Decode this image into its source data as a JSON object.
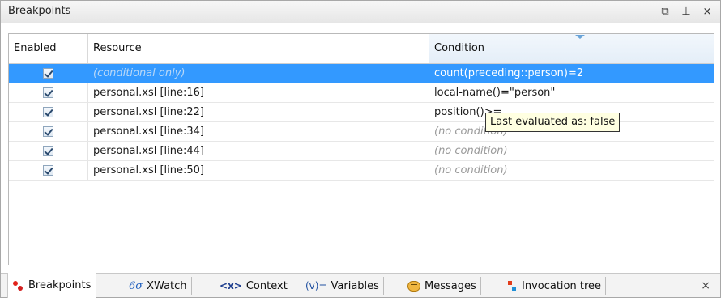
{
  "panel": {
    "title": "Breakpoints",
    "controls": {
      "restore_glyph": "⧉",
      "pin_glyph": "⊥",
      "close_glyph": "×"
    }
  },
  "table": {
    "headers": {
      "enabled": "Enabled",
      "resource": "Resource",
      "condition": "Condition"
    },
    "rows": [
      {
        "enabled": true,
        "resource": "(conditional only)",
        "condition": "count(preceding::person)=2",
        "selected": true
      },
      {
        "enabled": true,
        "resource": "personal.xsl [line:16]",
        "condition": "local-name()=\"person\""
      },
      {
        "enabled": true,
        "resource": "personal.xsl [line:22]",
        "condition": "position()>="
      },
      {
        "enabled": true,
        "resource": "personal.xsl [line:34]",
        "condition": "(no condition)"
      },
      {
        "enabled": true,
        "resource": "personal.xsl [line:44]",
        "condition": "(no condition)"
      },
      {
        "enabled": true,
        "resource": "personal.xsl [line:50]",
        "condition": "(no condition)"
      }
    ]
  },
  "tooltip": {
    "text": "Last evaluated as: false"
  },
  "tabs": [
    {
      "label": "Breakpoints",
      "icon": "breakpoints-icon",
      "active": true
    },
    {
      "label": "XWatch",
      "icon": "xwatch-icon",
      "glyph": "6σ"
    },
    {
      "label": "Context",
      "icon": "context-icon",
      "glyph": "<x>"
    },
    {
      "label": "Variables",
      "icon": "variables-icon",
      "glyph": "(v)="
    },
    {
      "label": "Messages",
      "icon": "messages-icon"
    },
    {
      "label": "Invocation tree",
      "icon": "invocation-tree-icon"
    }
  ],
  "tabbar_close_glyph": "×",
  "colors": {
    "selection": "#3399ff",
    "tooltip_bg": "#ffffe1",
    "header_active": "#e4eef8"
  }
}
